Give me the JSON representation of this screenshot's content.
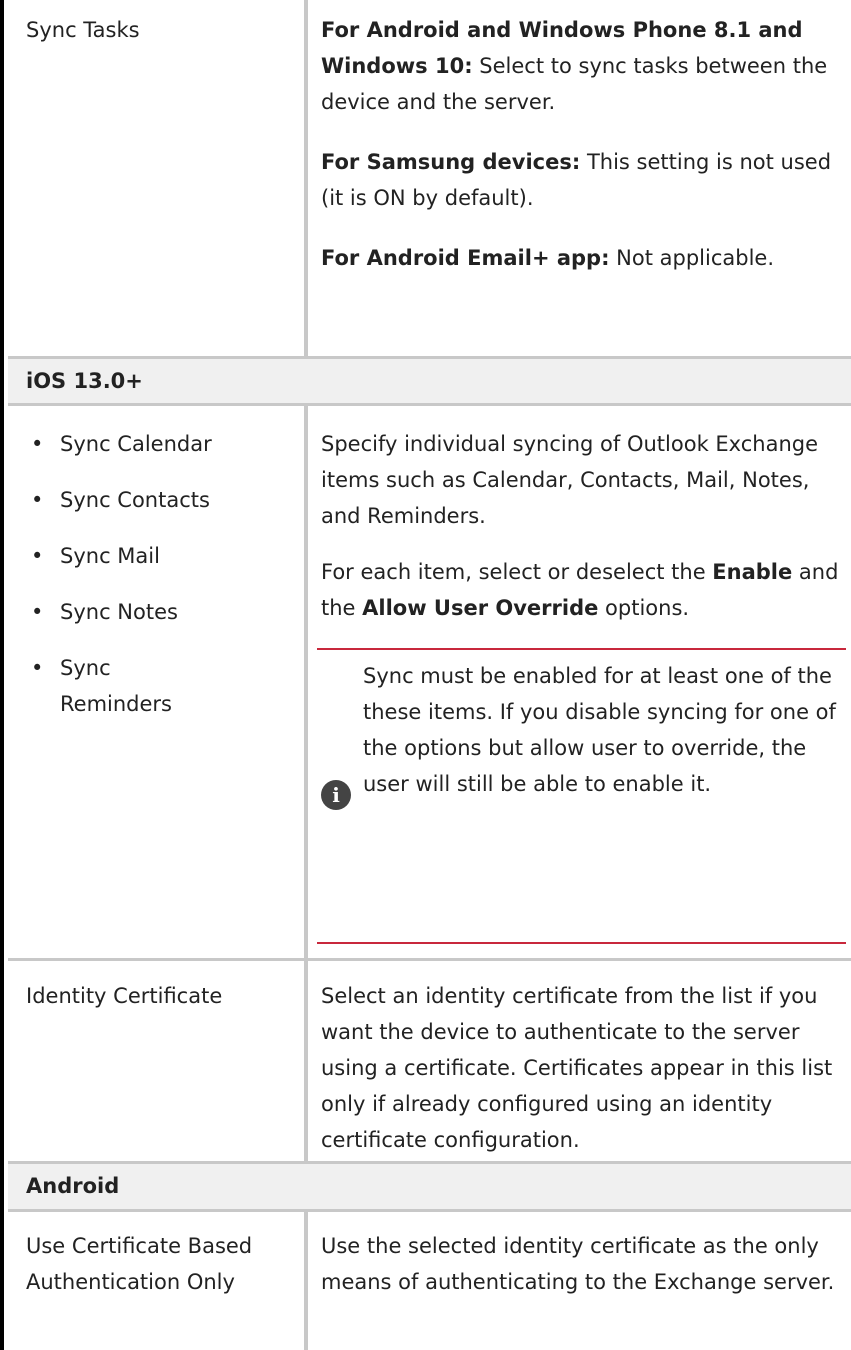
{
  "sync_tasks": {
    "label": "Sync Tasks",
    "p1_bold": "For Android and Windows Phone 8.1 and Windows 10:",
    "p1_text": " Select to sync tasks between the device and the server.",
    "p2_bold": "For Samsung devices:",
    "p2_text": " This setting is not used (it is ON by default).",
    "p3_bold": "For Android Email+ app:",
    "p3_text": " Not applicable."
  },
  "section_ios": "iOS 13.0+",
  "ios_sync": {
    "items": [
      "Sync Calendar",
      "Sync Contacts",
      "Sync Mail",
      "Sync Notes",
      "Sync Reminders"
    ],
    "desc1": "Specify individual syncing of Outlook Exchange items such as Calendar, Contacts, Mail, Notes, and Reminders.",
    "desc2_a": "For each item, select or deselect the ",
    "desc2_enable": "Enable",
    "desc2_b": " and the ",
    "desc2_override": "Allow User Override",
    "desc2_c": " options.",
    "note_icon": "info-icon",
    "note": "Sync must be enabled for at least one of the these items. If you disable syncing for one of the options but allow user to override, the user will still be able to enable it."
  },
  "identity_cert": {
    "label": "Identity Certificate",
    "desc": "Select an identity certificate from the list if you want the device to authenticate to the server using a certificate. Certificates appear in this list only if already configured using an identity certificate configuration."
  },
  "section_android": "Android",
  "cert_auth": {
    "label": "Use Certificate Based Authentication Only",
    "desc": "Use the selected identity certificate as the only means of authenticating to the Exchange server."
  },
  "colors": {
    "note_border": "#c8283c",
    "grid": "#c8c8c8",
    "section_bg": "#f0f0f0"
  }
}
